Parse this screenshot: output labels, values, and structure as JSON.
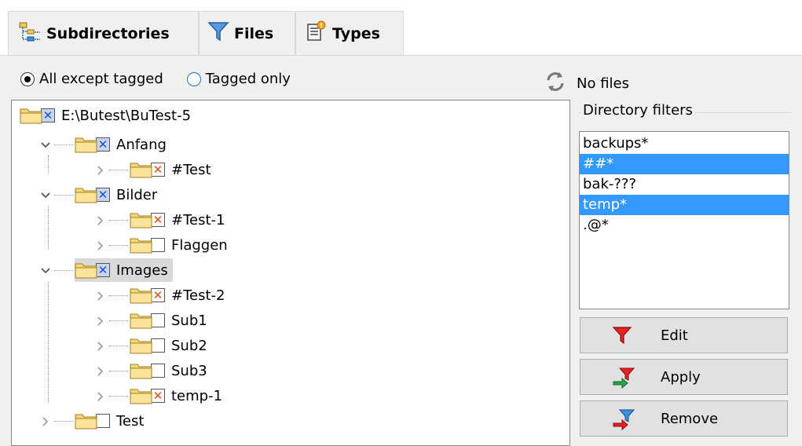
{
  "tabs": [
    {
      "label": "Subdirectories",
      "icon": "tree-icon",
      "active": true
    },
    {
      "label": "Files",
      "icon": "funnel-icon",
      "active": false
    },
    {
      "label": "Types",
      "icon": "document-types-icon",
      "active": false
    }
  ],
  "filter_mode": {
    "options": [
      {
        "label": "All except tagged",
        "selected": true
      },
      {
        "label": "Tagged only",
        "selected": false
      }
    ]
  },
  "status": {
    "label": "No files",
    "icon": "refresh-icon"
  },
  "tree": {
    "root": {
      "label": "E:\\Butest\\BuTest-5",
      "check": "blue"
    },
    "nodes": [
      {
        "label": "Anfang",
        "check": "blue"
      },
      {
        "label": "#Test",
        "check": "orange"
      },
      {
        "label": "Bilder",
        "check": "blue"
      },
      {
        "label": "#Test-1",
        "check": "orange"
      },
      {
        "label": "Flaggen",
        "check": "none"
      },
      {
        "label": "Images",
        "check": "blue"
      },
      {
        "label": "#Test-2",
        "check": "orange"
      },
      {
        "label": "Sub1",
        "check": "none"
      },
      {
        "label": "Sub2",
        "check": "none"
      },
      {
        "label": "Sub3",
        "check": "none"
      },
      {
        "label": "temp-1",
        "check": "orange"
      },
      {
        "label": "Test",
        "check": "none"
      }
    ]
  },
  "directory_filters": {
    "title": "Directory filters",
    "items": [
      {
        "label": "backups*",
        "selected": false
      },
      {
        "label": "##*",
        "selected": true
      },
      {
        "label": "bak-???",
        "selected": false
      },
      {
        "label": "temp*",
        "selected": true
      },
      {
        "label": ".@*",
        "selected": false
      }
    ]
  },
  "buttons": {
    "edit": "Edit",
    "apply": "Apply",
    "remove": "Remove"
  },
  "colors": {
    "selection": "#3399ff",
    "check_blue": "#1c4fc7",
    "check_orange": "#d4501a",
    "folder": "#f5d77a"
  }
}
